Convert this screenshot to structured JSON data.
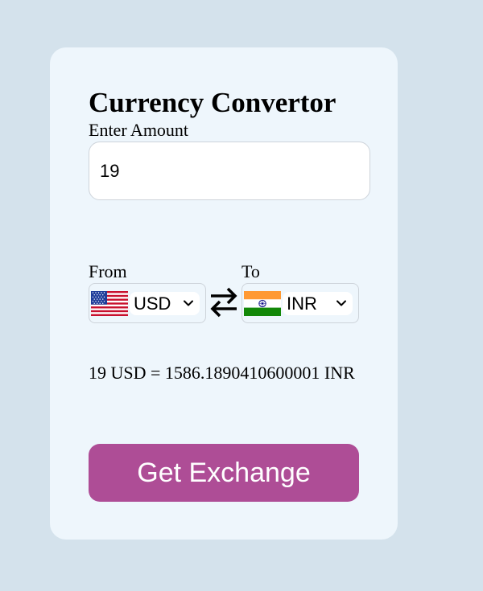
{
  "converter": {
    "title": "Currency Convertor",
    "amount_label": "Enter Amount",
    "amount_value": "19",
    "from": {
      "label": "From",
      "currency": "USD",
      "flag": "us-flag-icon"
    },
    "to": {
      "label": "To",
      "currency": "INR",
      "flag": "india-flag-icon"
    },
    "swap_icon": "swap-arrows-icon",
    "result": "19 USD = 1586.1890410600001 INR",
    "button_label": "Get Exchange"
  },
  "colors": {
    "page_background": "#d4e2ec",
    "card_background": "#eef6fc",
    "button_background": "#ae4d96",
    "button_text": "#ffffff"
  }
}
